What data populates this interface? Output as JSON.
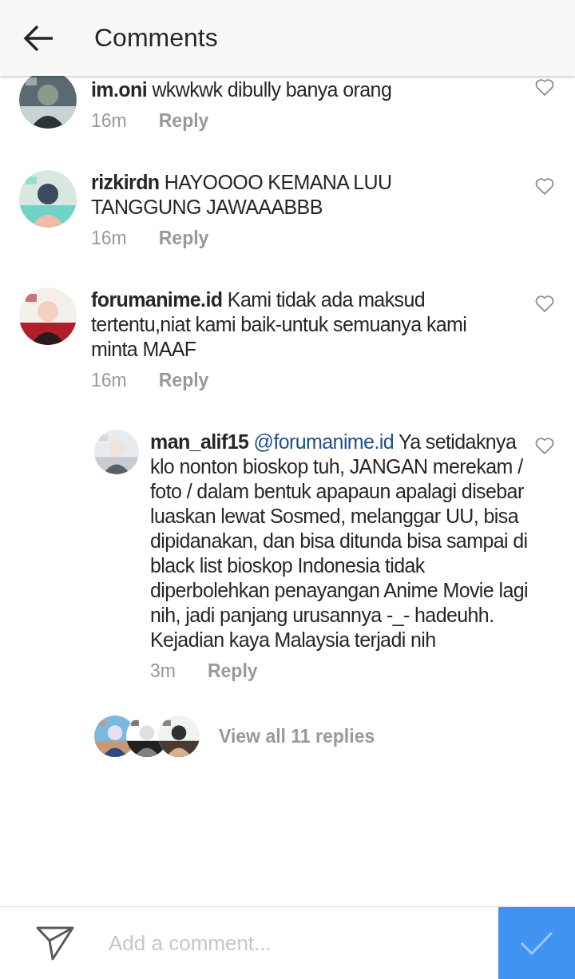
{
  "header": {
    "title": "Comments"
  },
  "comments": [
    {
      "user": "im.oni",
      "text": "wkwkwk dibully banya orang",
      "time": "16m",
      "reply": "Reply"
    },
    {
      "user": "rizkirdn",
      "text": "HAYOOOO KEMANA LUU TANGGUNG JAWAAABBB",
      "time": "16m",
      "reply": "Reply"
    },
    {
      "user": "forumanime.id",
      "text": "Kami tidak ada maksud tertentu,niat kami baik-untuk semuanya kami minta MAAF",
      "time": "16m",
      "reply": "Reply",
      "replies": [
        {
          "user": "man_alif15",
          "mention": "@forumanime.id",
          "text": "Ya setidaknya klo nonton bioskop tuh, JANGAN merekam / foto / dalam bentuk apapaun apalagi disebar luaskan lewat Sosmed, melanggar UU, bisa dipidanakan, dan bisa ditunda bisa sampai di black list bioskop Indonesia tidak diperbolehkan penayangan Anime Movie lagi nih, jadi panjang urusannya -_- hadeuhh. Kejadian kaya Malaysia terjadi nih",
          "time": "3m",
          "reply": "Reply"
        }
      ],
      "view_replies": "View all 11 replies"
    }
  ],
  "composer": {
    "placeholder": "Add a comment..."
  }
}
